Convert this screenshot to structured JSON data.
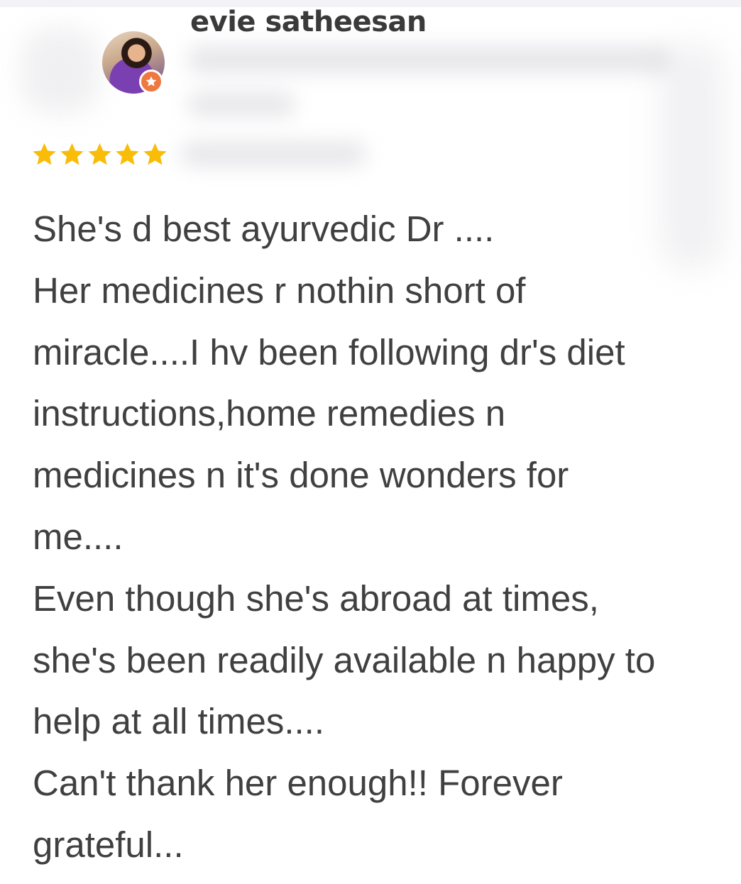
{
  "review": {
    "reviewer_name": "evie satheesan",
    "avatar_icon": "avatar-photo",
    "badge_icon": "local-guide-star-icon",
    "rating": 5,
    "rating_max": 5,
    "text": "She's d best ayurvedic Dr ....\nHer medicines r nothin short of\nmiracle....I hv been following dr's diet\ninstructions,home remedies n\nmedicines n it's done wonders for\nme....\nEven though she's abroad at times,\nshe's been readily available n happy to\nhelp at all times....\nCan't thank her enough!! Forever\ngrateful..."
  },
  "colors": {
    "star": "#f9bc08",
    "badge": "#ef7840",
    "text": "#404040",
    "name": "#3a3a3a"
  }
}
